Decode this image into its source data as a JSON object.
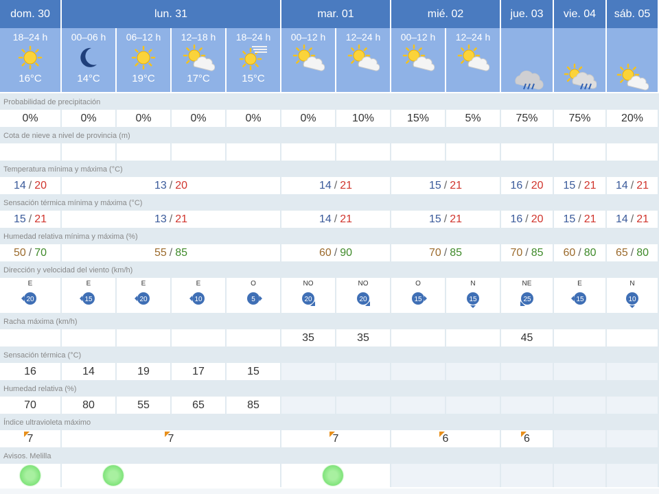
{
  "days": [
    {
      "label": "dom. 30"
    },
    {
      "label": "lun. 31"
    },
    {
      "label": "mar. 01"
    },
    {
      "label": "mié. 02"
    },
    {
      "label": "jue. 03"
    },
    {
      "label": "vie. 04"
    },
    {
      "label": "sáb. 05"
    }
  ],
  "periods": [
    {
      "label": "18–24 h",
      "icon": "sun-icon",
      "temp": "16°C"
    },
    {
      "label": "00–06 h",
      "icon": "moon-icon",
      "temp": "14°C"
    },
    {
      "label": "06–12 h",
      "icon": "sun-icon",
      "temp": "19°C"
    },
    {
      "label": "12–18 h",
      "icon": "sun-cloud-icon",
      "temp": "17°C"
    },
    {
      "label": "18–24 h",
      "icon": "sun-haze-icon",
      "temp": "15°C"
    },
    {
      "label": "00–12 h",
      "icon": "sun-cloud-icon",
      "temp": ""
    },
    {
      "label": "12–24 h",
      "icon": "sun-cloud-icon",
      "temp": ""
    },
    {
      "label": "00–12 h",
      "icon": "sun-cloud-icon",
      "temp": ""
    },
    {
      "label": "12–24 h",
      "icon": "sun-cloud-icon",
      "temp": ""
    },
    {
      "label": "",
      "icon": "rain-cloud-icon",
      "temp": ""
    },
    {
      "label": "",
      "icon": "sun-rain-icon",
      "temp": ""
    },
    {
      "label": "",
      "icon": "sun-cloud-icon",
      "temp": ""
    }
  ],
  "labels": {
    "precip": "Probabilidad de precipitación",
    "snow": "Cota de nieve a nivel de provincia (m)",
    "temp": "Temperatura mínima y máxima (°C)",
    "feels": "Sensación térmica mínima y máxima (°C)",
    "hum": "Humedad relativa mínima y máxima (%)",
    "wind": "Dirección y velocidad del viento (km/h)",
    "gust": "Racha máxima (km/h)",
    "feels_now": "Sensación térmica (°C)",
    "hum_now": "Humedad relativa (%)",
    "uv": "Índice ultravioleta máximo",
    "avisos": "Avisos. Melilla"
  },
  "precip": [
    "0%",
    "0%",
    "0%",
    "0%",
    "0%",
    "0%",
    "10%",
    "15%",
    "5%",
    "75%",
    "75%",
    "20%"
  ],
  "temp_minmax": [
    {
      "min": "14",
      "max": "20"
    },
    {
      "min": "13",
      "max": "20"
    },
    {
      "min": "14",
      "max": "21"
    },
    {
      "min": "15",
      "max": "21"
    },
    {
      "min": "16",
      "max": "20"
    },
    {
      "min": "15",
      "max": "21"
    },
    {
      "min": "14",
      "max": "21"
    }
  ],
  "feels_minmax": [
    {
      "min": "15",
      "max": "21"
    },
    {
      "min": "13",
      "max": "21"
    },
    {
      "min": "14",
      "max": "21"
    },
    {
      "min": "15",
      "max": "21"
    },
    {
      "min": "16",
      "max": "20"
    },
    {
      "min": "15",
      "max": "21"
    },
    {
      "min": "14",
      "max": "21"
    }
  ],
  "hum_minmax": [
    {
      "min": "50",
      "max": "70"
    },
    {
      "min": "55",
      "max": "85"
    },
    {
      "min": "60",
      "max": "90"
    },
    {
      "min": "70",
      "max": "85"
    },
    {
      "min": "70",
      "max": "85"
    },
    {
      "min": "60",
      "max": "80"
    },
    {
      "min": "65",
      "max": "80"
    }
  ],
  "wind": [
    {
      "dir": "E",
      "speed": "20"
    },
    {
      "dir": "E",
      "speed": "15"
    },
    {
      "dir": "E",
      "speed": "20"
    },
    {
      "dir": "E",
      "speed": "10"
    },
    {
      "dir": "O",
      "speed": "5"
    },
    {
      "dir": "NO",
      "speed": "20"
    },
    {
      "dir": "NO",
      "speed": "20"
    },
    {
      "dir": "O",
      "speed": "15"
    },
    {
      "dir": "N",
      "speed": "15"
    },
    {
      "dir": "NE",
      "speed": "25"
    },
    {
      "dir": "E",
      "speed": "15"
    },
    {
      "dir": "N",
      "speed": "10"
    }
  ],
  "gust": [
    "",
    "",
    "",
    "",
    "",
    "35",
    "35",
    "",
    "",
    "45",
    "",
    ""
  ],
  "feels_now": [
    "16",
    "14",
    "19",
    "17",
    "15"
  ],
  "hum_now": [
    "70",
    "80",
    "55",
    "65",
    "85"
  ],
  "uv": [
    "7",
    "7",
    "7",
    "6",
    "6"
  ],
  "colors": {
    "header": "#4a7bc0",
    "period": "#8fb2e6",
    "label_bg": "#e1eaf0",
    "min": "#3a5a9a",
    "max": "#d0342c",
    "wind_badge": "#3f6fb5",
    "uv": "#e8901c",
    "aviso": "#7fe37a"
  }
}
